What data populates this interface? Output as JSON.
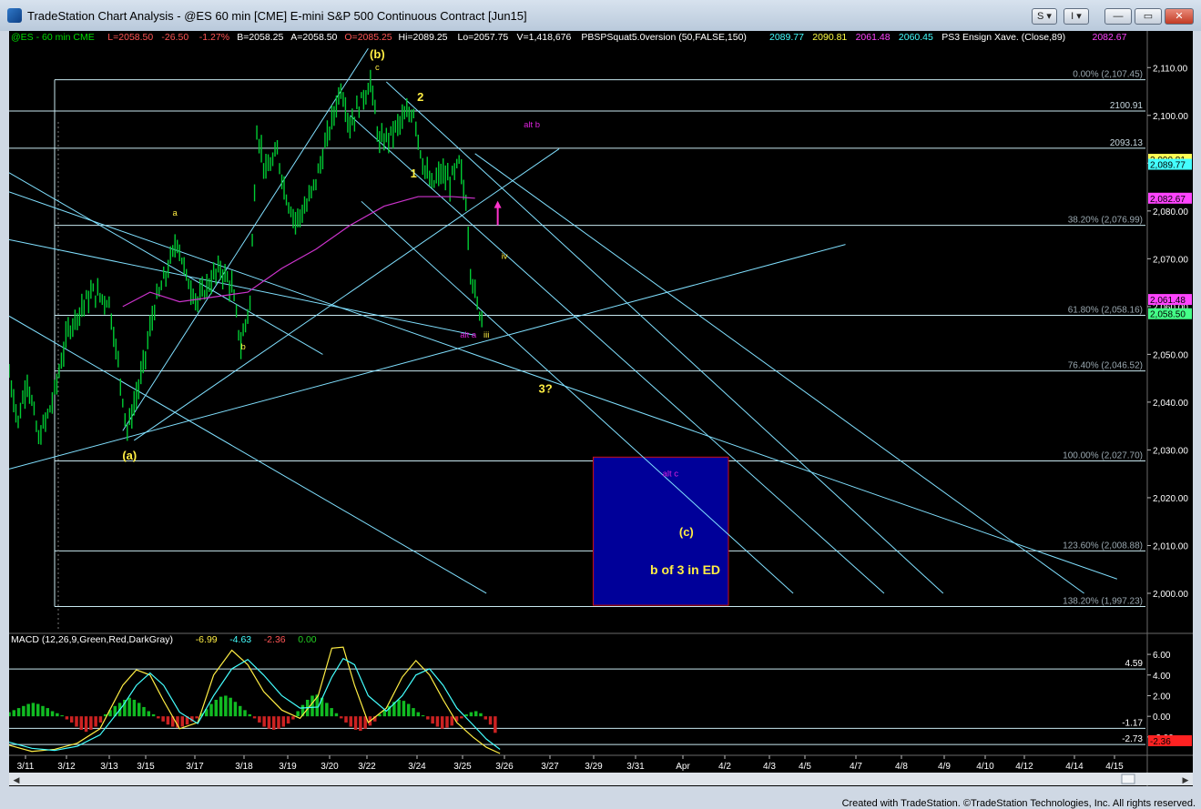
{
  "window": {
    "title": "TradeStation Chart Analysis - @ES 60 min [CME] E-mini S&P 500 Continuous Contract [Jun15]",
    "buttons": {
      "s_label": "S ▾",
      "i_label": "I ▾",
      "min_label": "—",
      "max_label": "▭",
      "close_label": "✕"
    }
  },
  "footer": {
    "credit": "Created with TradeStation. ©TradeStation Technologies, Inc. All rights reserved."
  },
  "colors": {
    "background": "#000000",
    "price_bars": "#00cc33",
    "lines": "#80e0ff",
    "ma": "#cc33cc",
    "wave_labels": "#ffee44",
    "alt_labels": "#dd22dd",
    "box_fill": "#000099",
    "box_border": "#cc1111"
  },
  "header": {
    "segments": [
      {
        "text": "@ES - 60 min  CME",
        "color": "#00dd00"
      },
      {
        "text": "L=2058.50",
        "color": "#ff5555"
      },
      {
        "text": "-26.50",
        "color": "#ff5555"
      },
      {
        "text": "-1.27%",
        "color": "#ff5555"
      },
      {
        "text": "B=2058.25",
        "color": "#ffffff"
      },
      {
        "text": "A=2058.50",
        "color": "#ffffff"
      },
      {
        "text": "O=2085.25",
        "color": "#ff5555"
      },
      {
        "text": "Hi=2089.25",
        "color": "#ffffff"
      },
      {
        "text": "Lo=2057.75",
        "color": "#ffffff"
      },
      {
        "text": "V=1,418,676",
        "color": "#ffffff"
      },
      {
        "text": "PBSPSquat5.0version (50,FALSE,150)",
        "color": "#ffffff"
      },
      {
        "text": "2089.77",
        "color": "#44ffff"
      },
      {
        "text": "2090.81",
        "color": "#ffff44"
      },
      {
        "text": "2061.48",
        "color": "#ff44ff"
      },
      {
        "text": "2060.45",
        "color": "#44ffff"
      },
      {
        "text": "PS3 Ensign Xave. (Close,89)",
        "color": "#ffffff"
      },
      {
        "text": "2082.67",
        "color": "#ff44ff"
      }
    ]
  },
  "chart_data": {
    "type": "ohlc",
    "title": "",
    "ylim": [
      1992,
      2115
    ],
    "y_ticks": [
      2110,
      2100,
      2090,
      2080,
      2070,
      2060,
      2050,
      2040,
      2030,
      2020,
      2010,
      2000
    ],
    "y_tick_labels": [
      "2,110.00",
      "2,100.00",
      "2,090.00",
      "2,080.00",
      "2,070.00",
      "2,060.00",
      "2,050.00",
      "2,040.00",
      "2,030.00",
      "2,020.00",
      "2,010.00",
      "2,000.00"
    ],
    "x_tick_labels": [
      "3/11",
      "3/12",
      "3/13",
      "3/15",
      "3/17",
      "3/18",
      "3/19",
      "3/20",
      "3/22",
      "3/24",
      "3/25",
      "3/26",
      "3/27",
      "3/29",
      "3/31",
      "Apr",
      "4/2",
      "4/3",
      "4/5",
      "4/7",
      "4/8",
      "4/9",
      "4/10",
      "4/12",
      "4/14",
      "4/15"
    ],
    "price_path": [
      {
        "bar": 0,
        "price": 2046
      },
      {
        "bar": 8,
        "price": 2036
      },
      {
        "bar": 16,
        "price": 2045
      },
      {
        "bar": 26,
        "price": 2032
      },
      {
        "bar": 38,
        "price": 2040
      },
      {
        "bar": 52,
        "price": 2055
      },
      {
        "bar": 64,
        "price": 2060
      },
      {
        "bar": 74,
        "price": 2063
      },
      {
        "bar": 88,
        "price": 2061
      },
      {
        "bar": 96,
        "price": 2048
      },
      {
        "bar": 104,
        "price": 2034
      },
      {
        "bar": 116,
        "price": 2045
      },
      {
        "bar": 128,
        "price": 2060
      },
      {
        "bar": 140,
        "price": 2068
      },
      {
        "bar": 148,
        "price": 2074
      },
      {
        "bar": 156,
        "price": 2066
      },
      {
        "bar": 166,
        "price": 2061
      },
      {
        "bar": 176,
        "price": 2065
      },
      {
        "bar": 186,
        "price": 2068
      },
      {
        "bar": 196,
        "price": 2064
      },
      {
        "bar": 204,
        "price": 2052
      },
      {
        "bar": 212,
        "price": 2061
      },
      {
        "bar": 218,
        "price": 2097
      },
      {
        "bar": 226,
        "price": 2088
      },
      {
        "bar": 236,
        "price": 2092
      },
      {
        "bar": 244,
        "price": 2083
      },
      {
        "bar": 252,
        "price": 2078
      },
      {
        "bar": 262,
        "price": 2081
      },
      {
        "bar": 272,
        "price": 2088
      },
      {
        "bar": 282,
        "price": 2097
      },
      {
        "bar": 292,
        "price": 2106
      },
      {
        "bar": 300,
        "price": 2098
      },
      {
        "bar": 308,
        "price": 2102
      },
      {
        "bar": 318,
        "price": 2107
      },
      {
        "bar": 326,
        "price": 2094
      },
      {
        "bar": 336,
        "price": 2096
      },
      {
        "bar": 346,
        "price": 2099
      },
      {
        "bar": 356,
        "price": 2101
      },
      {
        "bar": 364,
        "price": 2090
      },
      {
        "bar": 372,
        "price": 2085
      },
      {
        "bar": 380,
        "price": 2088
      },
      {
        "bar": 388,
        "price": 2086
      },
      {
        "bar": 396,
        "price": 2090
      },
      {
        "bar": 402,
        "price": 2082
      },
      {
        "bar": 406,
        "price": 2068
      },
      {
        "bar": 412,
        "price": 2060
      },
      {
        "bar": 416,
        "price": 2058
      }
    ],
    "ma89": [
      {
        "bar": 100,
        "price": 2060
      },
      {
        "bar": 124,
        "price": 2063
      },
      {
        "bar": 150,
        "price": 2061
      },
      {
        "bar": 180,
        "price": 2062
      },
      {
        "bar": 210,
        "price": 2063
      },
      {
        "bar": 240,
        "price": 2068
      },
      {
        "bar": 270,
        "price": 2072
      },
      {
        "bar": 300,
        "price": 2077
      },
      {
        "bar": 330,
        "price": 2081
      },
      {
        "bar": 360,
        "price": 2083
      },
      {
        "bar": 390,
        "price": 2083
      },
      {
        "bar": 410,
        "price": 2082.67
      }
    ],
    "fib_levels": [
      {
        "label": "0.00% (2,107.45)",
        "value": 2107.45
      },
      {
        "label": "38.20% (2,076.99)",
        "value": 2076.99
      },
      {
        "label": "61.80% (2,058.16)",
        "value": 2058.16
      },
      {
        "label": "76.40% (2,046.52)",
        "value": 2046.52
      },
      {
        "label": "100.00% (2,027.70)",
        "value": 2027.7
      },
      {
        "label": "123.60% (2,008.88)",
        "value": 2008.88
      },
      {
        "label": "138.20% (1,997.23)",
        "value": 1997.23
      }
    ],
    "h_levels": [
      {
        "label": "2100.91",
        "value": 2100.91
      },
      {
        "label": "2093.13",
        "value": 2093.13
      }
    ],
    "price_markers": [
      {
        "label": "2,090.81",
        "value": 2090.81,
        "bg": "#ffff55"
      },
      {
        "label": "2,089.77",
        "value": 2089.77,
        "bg": "#44ffff"
      },
      {
        "label": "2,082.67",
        "value": 2082.67,
        "bg": "#ff44ff"
      },
      {
        "label": "2,061.48",
        "value": 2061.48,
        "bg": "#ff44ff"
      },
      {
        "label": "2,058.50",
        "value": 2058.5,
        "bg": "#44ff88"
      }
    ],
    "annotations": [
      {
        "text": "(b)",
        "bar": 324,
        "price": 2112,
        "color": "#ffee44"
      },
      {
        "text": "c",
        "bar": 324,
        "price": 2109.5,
        "color": "#ffee44"
      },
      {
        "text": "2",
        "bar": 362,
        "price": 2103,
        "color": "#ffee44"
      },
      {
        "text": "1",
        "bar": 356,
        "price": 2087,
        "color": "#ffee44"
      },
      {
        "text": "alt b",
        "bar": 460,
        "price": 2097.5,
        "color": "#dd22dd"
      },
      {
        "text": "a",
        "bar": 146,
        "price": 2079,
        "color": "#ffee44"
      },
      {
        "text": "b",
        "bar": 206,
        "price": 2051,
        "color": "#ffee44"
      },
      {
        "text": "(a)",
        "bar": 106,
        "price": 2028,
        "color": "#ffee44"
      },
      {
        "text": "iv",
        "bar": 436,
        "price": 2070,
        "color": "#ffee44"
      },
      {
        "text": "alt a",
        "bar": 404,
        "price": 2053.5,
        "color": "#dd22dd"
      },
      {
        "text": "iii",
        "bar": 420,
        "price": 2053.5,
        "color": "#ffee44"
      },
      {
        "text": "3?",
        "bar": 472,
        "price": 2042,
        "color": "#ffee44"
      },
      {
        "text": "alt c",
        "bar": 582,
        "price": 2024.5,
        "color": "#dd22dd"
      },
      {
        "text": "(c)",
        "bar": 596,
        "price": 2012,
        "color": "#ffee44"
      },
      {
        "text": "b of 3 in ED",
        "bar": 595,
        "price": 2004,
        "color": "#ffee44"
      }
    ],
    "trendlines": [
      {
        "from": [
          0,
          2088
        ],
        "to": [
          276,
          2050
        ]
      },
      {
        "from": [
          0,
          2074
        ],
        "to": [
          410,
          2054
        ]
      },
      {
        "from": [
          0,
          2058
        ],
        "to": [
          420,
          2000
        ]
      },
      {
        "from": [
          0,
          2084
        ],
        "to": [
          975,
          2003
        ]
      },
      {
        "from": [
          0,
          2026
        ],
        "to": [
          736,
          2073
        ]
      },
      {
        "from": [
          110,
          2032
        ],
        "to": [
          484,
          2093
        ]
      },
      {
        "from": [
          100,
          2034
        ],
        "to": [
          316,
          2114
        ]
      },
      {
        "from": [
          300,
          2100
        ],
        "to": [
          770,
          2000
        ]
      },
      {
        "from": [
          332,
          2107
        ],
        "to": [
          822,
          2000
        ]
      },
      {
        "from": [
          310,
          2082
        ],
        "to": [
          690,
          2000
        ]
      },
      {
        "from": [
          410,
          2092
        ],
        "to": [
          946,
          2000
        ]
      }
    ],
    "target_box": {
      "bar_start": 514,
      "bar_end": 633,
      "top": 2028.5,
      "bottom": 1997.5
    },
    "arrow": {
      "bar": 430,
      "from": 2077,
      "to": 2081,
      "color": "#ff33cc"
    }
  },
  "macd": {
    "legend": [
      {
        "text": "MACD (12,26,9,Green,Red,DarkGray)",
        "color": "#ffffff"
      },
      {
        "text": "-6.99",
        "color": "#ffee44"
      },
      {
        "text": "-4.63",
        "color": "#44ffff"
      },
      {
        "text": "-2.36",
        "color": "#ff5555"
      },
      {
        "text": "0.00",
        "color": "#22cc22"
      }
    ],
    "ylim": [
      -3.6,
      6.8
    ],
    "y_tick_labels": [
      {
        "label": "6.00",
        "value": 6
      },
      {
        "label": "4.00",
        "value": 4
      },
      {
        "label": "2.00",
        "value": 2
      },
      {
        "label": "0.00",
        "value": 0
      },
      {
        "label": "-2.00",
        "value": -2
      }
    ],
    "levels": [
      {
        "label": "4.59",
        "value": 4.59
      },
      {
        "label": "-1.17",
        "value": -1.17
      },
      {
        "label": "-2.73",
        "value": -2.73
      }
    ],
    "marker": {
      "label": "-2.36",
      "value": -2.36
    },
    "series": [
      {
        "name": "MACD",
        "color": "#ffee44",
        "points": [
          [
            0,
            -2.8
          ],
          [
            20,
            -3.4
          ],
          [
            40,
            -3.2
          ],
          [
            60,
            -2.6
          ],
          [
            80,
            -1.2
          ],
          [
            100,
            3.0
          ],
          [
            112,
            4.5
          ],
          [
            124,
            4.0
          ],
          [
            136,
            1.5
          ],
          [
            150,
            -1.2
          ],
          [
            166,
            -0.6
          ],
          [
            180,
            4.0
          ],
          [
            196,
            6.4
          ],
          [
            210,
            5.0
          ],
          [
            224,
            2.4
          ],
          [
            240,
            0.6
          ],
          [
            256,
            -0.2
          ],
          [
            272,
            2.0
          ],
          [
            284,
            6.6
          ],
          [
            294,
            6.7
          ],
          [
            304,
            3.0
          ],
          [
            316,
            -0.6
          ],
          [
            332,
            0.8
          ],
          [
            346,
            3.8
          ],
          [
            358,
            5.4
          ],
          [
            370,
            4.0
          ],
          [
            382,
            1.6
          ],
          [
            394,
            -0.6
          ],
          [
            408,
            -2.0
          ],
          [
            420,
            -3.0
          ],
          [
            432,
            -3.6
          ]
        ]
      },
      {
        "name": "Signal",
        "color": "#44ffff",
        "points": [
          [
            0,
            -2.5
          ],
          [
            20,
            -3.1
          ],
          [
            40,
            -3.3
          ],
          [
            60,
            -2.9
          ],
          [
            80,
            -1.8
          ],
          [
            100,
            1.0
          ],
          [
            112,
            3.0
          ],
          [
            124,
            4.2
          ],
          [
            136,
            3.0
          ],
          [
            150,
            0.4
          ],
          [
            166,
            -0.7
          ],
          [
            180,
            2.0
          ],
          [
            196,
            4.6
          ],
          [
            210,
            5.5
          ],
          [
            224,
            4.0
          ],
          [
            240,
            2.0
          ],
          [
            256,
            0.8
          ],
          [
            272,
            0.9
          ],
          [
            284,
            3.8
          ],
          [
            294,
            5.6
          ],
          [
            304,
            5.0
          ],
          [
            316,
            2.0
          ],
          [
            332,
            0.5
          ],
          [
            346,
            2.0
          ],
          [
            358,
            4.0
          ],
          [
            370,
            4.6
          ],
          [
            382,
            3.0
          ],
          [
            394,
            0.8
          ],
          [
            408,
            -0.8
          ],
          [
            420,
            -2.2
          ],
          [
            432,
            -3.2
          ]
        ]
      }
    ],
    "histogram": [
      0.4,
      0.6,
      0.8,
      1.0,
      1.2,
      1.3,
      1.2,
      1.0,
      0.8,
      0.5,
      0.3,
      0.1,
      -0.3,
      -0.6,
      -1.0,
      -1.3,
      -1.5,
      -1.3,
      -1.0,
      -0.6,
      0.2,
      0.6,
      1.0,
      1.3,
      1.6,
      1.8,
      1.6,
      1.3,
      0.9,
      0.5,
      0.2,
      -0.2,
      -0.5,
      -0.8,
      -1.0,
      -1.1,
      -1.0,
      -0.8,
      -0.5,
      -0.2,
      0.3,
      0.7,
      1.2,
      1.6,
      1.9,
      2.0,
      1.8,
      1.4,
      1.0,
      0.6,
      0.2,
      -0.2,
      -0.6,
      -1.0,
      -1.2,
      -1.3,
      -1.2,
      -1.0,
      -0.7,
      -0.3,
      0.5,
      1.1,
      1.6,
      2.0,
      2.1,
      1.8,
      1.3,
      0.8,
      0.3,
      -0.2,
      -0.6,
      -1.0,
      -1.3,
      -1.4,
      -1.2,
      -0.9,
      -0.5,
      0.2,
      0.6,
      1.0,
      1.4,
      1.6,
      1.5,
      1.2,
      0.8,
      0.4,
      0.1,
      -0.3,
      -0.7,
      -1.0,
      -1.2,
      -1.1,
      -0.9,
      -0.5,
      -0.2,
      0.2,
      0.4,
      0.5,
      0.3,
      -0.3,
      -0.8,
      -1.6
    ]
  }
}
